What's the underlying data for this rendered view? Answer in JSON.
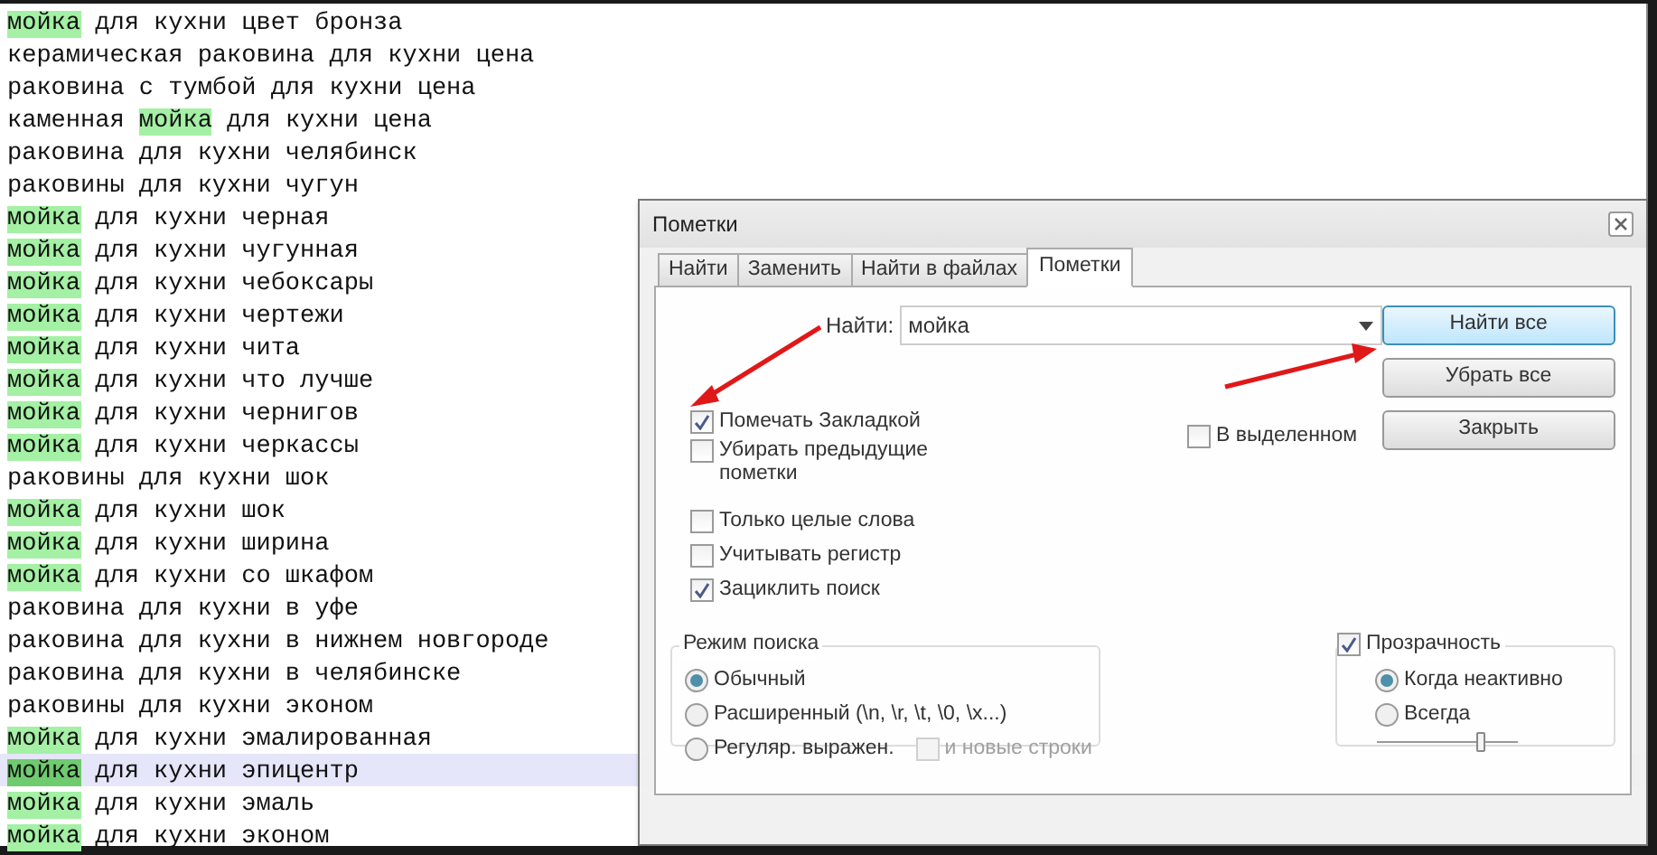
{
  "editor": {
    "lines": [
      {
        "parts": [
          {
            "text": "мойка",
            "marked": true
          },
          {
            "text": " для кухни цвет бронза",
            "marked": false
          }
        ],
        "current": false
      },
      {
        "parts": [
          {
            "text": "керамическая раковина для кухни цена",
            "marked": false
          }
        ],
        "current": false
      },
      {
        "parts": [
          {
            "text": "раковина с тумбой для кухни цена",
            "marked": false
          }
        ],
        "current": false
      },
      {
        "parts": [
          {
            "text": "каменная ",
            "marked": false
          },
          {
            "text": "мойка",
            "marked": true
          },
          {
            "text": " для кухни цена",
            "marked": false
          }
        ],
        "current": false
      },
      {
        "parts": [
          {
            "text": "раковина для кухни челябинск",
            "marked": false
          }
        ],
        "current": false
      },
      {
        "parts": [
          {
            "text": "раковины для кухни чугун",
            "marked": false
          }
        ],
        "current": false
      },
      {
        "parts": [
          {
            "text": "мойка",
            "marked": true
          },
          {
            "text": " для кухни черная",
            "marked": false
          }
        ],
        "current": false
      },
      {
        "parts": [
          {
            "text": "мойка",
            "marked": true
          },
          {
            "text": " для кухни чугунная",
            "marked": false
          }
        ],
        "current": false
      },
      {
        "parts": [
          {
            "text": "мойка",
            "marked": true
          },
          {
            "text": " для кухни чебоксары",
            "marked": false
          }
        ],
        "current": false
      },
      {
        "parts": [
          {
            "text": "мойка",
            "marked": true
          },
          {
            "text": " для кухни чертежи",
            "marked": false
          }
        ],
        "current": false
      },
      {
        "parts": [
          {
            "text": "мойка",
            "marked": true
          },
          {
            "text": " для кухни чита",
            "marked": false
          }
        ],
        "current": false
      },
      {
        "parts": [
          {
            "text": "мойка",
            "marked": true
          },
          {
            "text": " для кухни что лучше",
            "marked": false
          }
        ],
        "current": false
      },
      {
        "parts": [
          {
            "text": "мойка",
            "marked": true
          },
          {
            "text": " для кухни чернигов",
            "marked": false
          }
        ],
        "current": false
      },
      {
        "parts": [
          {
            "text": "мойка",
            "marked": true
          },
          {
            "text": " для кухни черкассы",
            "marked": false
          }
        ],
        "current": false
      },
      {
        "parts": [
          {
            "text": "раковины для кухни шок",
            "marked": false
          }
        ],
        "current": false
      },
      {
        "parts": [
          {
            "text": "мойка",
            "marked": true
          },
          {
            "text": " для кухни шок",
            "marked": false
          }
        ],
        "current": false
      },
      {
        "parts": [
          {
            "text": "мойка",
            "marked": true
          },
          {
            "text": " для кухни ширина",
            "marked": false
          }
        ],
        "current": false
      },
      {
        "parts": [
          {
            "text": "мойка",
            "marked": true
          },
          {
            "text": " для кухни со шкафом",
            "marked": false
          }
        ],
        "current": false
      },
      {
        "parts": [
          {
            "text": "раковина для кухни в уфе",
            "marked": false
          }
        ],
        "current": false
      },
      {
        "parts": [
          {
            "text": "раковина для кухни в нижнем новгороде",
            "marked": false
          }
        ],
        "current": false
      },
      {
        "parts": [
          {
            "text": "раковина для кухни в челябинске",
            "marked": false
          }
        ],
        "current": false
      },
      {
        "parts": [
          {
            "text": "раковины для кухни эконом",
            "marked": false
          }
        ],
        "current": false
      },
      {
        "parts": [
          {
            "text": "мойка",
            "marked": true
          },
          {
            "text": " для кухни эмалированная",
            "marked": false
          }
        ],
        "current": false
      },
      {
        "parts": [
          {
            "text": "мойка",
            "marked": true
          },
          {
            "text": " для кухни эпицентр",
            "marked": false
          }
        ],
        "current": true
      },
      {
        "parts": [
          {
            "text": "мойка",
            "marked": true
          },
          {
            "text": " для кухни эмаль",
            "marked": false
          }
        ],
        "current": false
      },
      {
        "parts": [
          {
            "text": "мойка",
            "marked": true
          },
          {
            "text": " для кухни эконом",
            "marked": false
          }
        ],
        "current": false
      }
    ]
  },
  "dialog": {
    "title": "Пометки",
    "tabs": [
      {
        "label": "Найти",
        "selected": false
      },
      {
        "label": "Заменить",
        "selected": false
      },
      {
        "label": "Найти в файлах",
        "selected": false
      },
      {
        "label": "Пометки",
        "selected": true
      }
    ],
    "find_label": "Найти:",
    "find_value": "мойка",
    "mark_options": [
      {
        "label": "Помечать Закладкой",
        "checked": true
      },
      {
        "label": "Убирать предыдущие пометки",
        "checked": false
      }
    ],
    "in_selection": {
      "label": "В выделенном",
      "checked": false
    },
    "options": [
      {
        "label": "Только целые слова",
        "checked": false
      },
      {
        "label": "Учитывать регистр",
        "checked": false
      },
      {
        "label": "Зациклить поиск",
        "checked": true
      }
    ],
    "buttons": [
      {
        "label": "Найти все",
        "focused": true
      },
      {
        "label": "Убрать все",
        "focused": false
      },
      {
        "label": "Закрыть",
        "focused": false
      }
    ],
    "search_mode": {
      "title": "Режим поиска",
      "options": [
        {
          "label": "Обычный",
          "selected": true
        },
        {
          "label": "Расширенный (\\n, \\r, \\t, \\0, \\x...)",
          "selected": false
        },
        {
          "label": "Регуляр. выражен.",
          "selected": false
        }
      ],
      "newlines": {
        "label": "и новые строки",
        "checked": false,
        "disabled": true
      }
    },
    "transparency": {
      "label": "Прозрачность",
      "checked": true,
      "options": [
        {
          "label": "Когда неактивно",
          "selected": true
        },
        {
          "label": "Всегда",
          "selected": false
        }
      ],
      "level": 0.73
    }
  }
}
